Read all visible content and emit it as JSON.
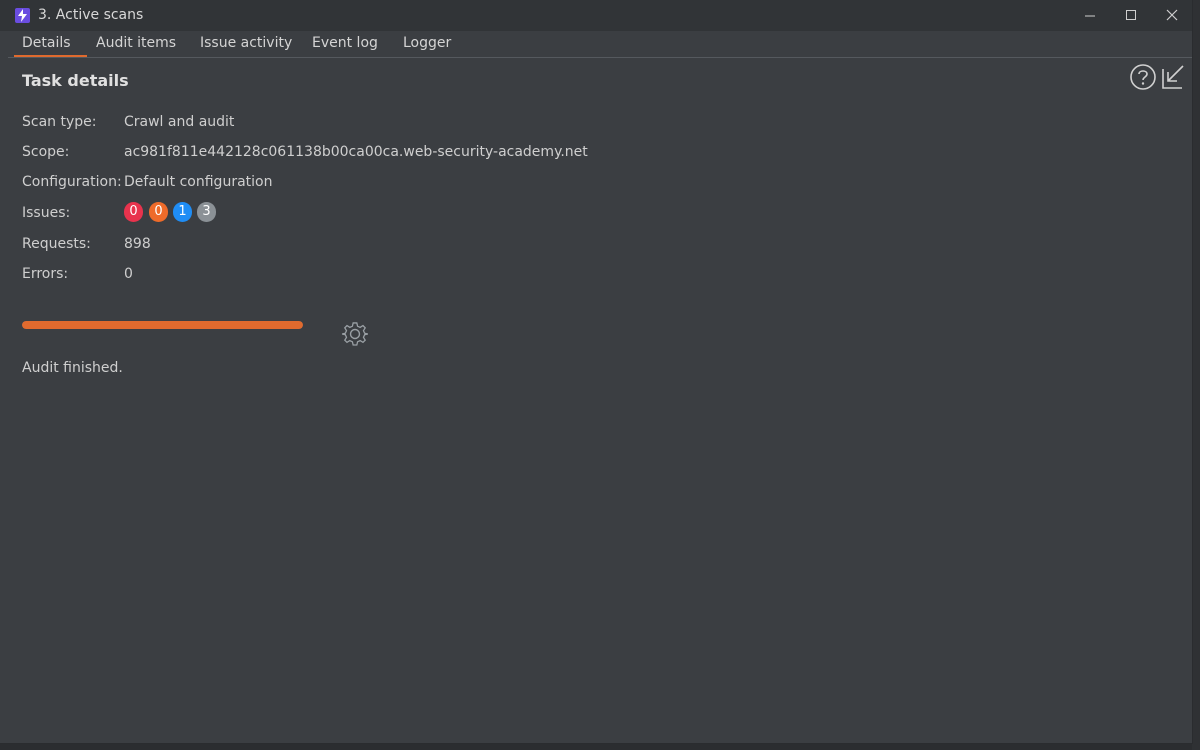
{
  "window": {
    "title": "3. Active scans"
  },
  "tabs": [
    {
      "label": "Details",
      "active": true
    },
    {
      "label": "Audit items",
      "active": false
    },
    {
      "label": "Issue activity",
      "active": false
    },
    {
      "label": "Event log",
      "active": false
    },
    {
      "label": "Logger",
      "active": false
    }
  ],
  "task": {
    "heading": "Task details",
    "rows": {
      "scan_type": {
        "label": "Scan type:",
        "value": "Crawl and audit"
      },
      "scope": {
        "label": "Scope:",
        "value": "ac981f811e442128c061138b00ca00ca.web-security-academy.net"
      },
      "configuration": {
        "label": "Configuration:",
        "value": "Default configuration"
      },
      "issues": {
        "label": "Issues:"
      },
      "requests": {
        "label": "Requests:",
        "value": "898"
      },
      "errors": {
        "label": "Errors:",
        "value": "0"
      }
    },
    "issue_badges": [
      {
        "count": "0",
        "severity": "high",
        "color": "#e8334d"
      },
      {
        "count": "0",
        "severity": "medium",
        "color": "#ee6b2a"
      },
      {
        "count": "1",
        "severity": "low",
        "color": "#1f8df5"
      },
      {
        "count": "3",
        "severity": "info",
        "color": "#8b9196"
      }
    ],
    "progress_percent": 100,
    "status": "Audit finished."
  },
  "colors": {
    "accent": "#e06a2e",
    "background": "#3b3e42"
  },
  "icons": [
    "app-icon",
    "minimize-icon",
    "maximize-icon",
    "close-icon",
    "help-icon",
    "popout-icon",
    "gear-icon"
  ]
}
